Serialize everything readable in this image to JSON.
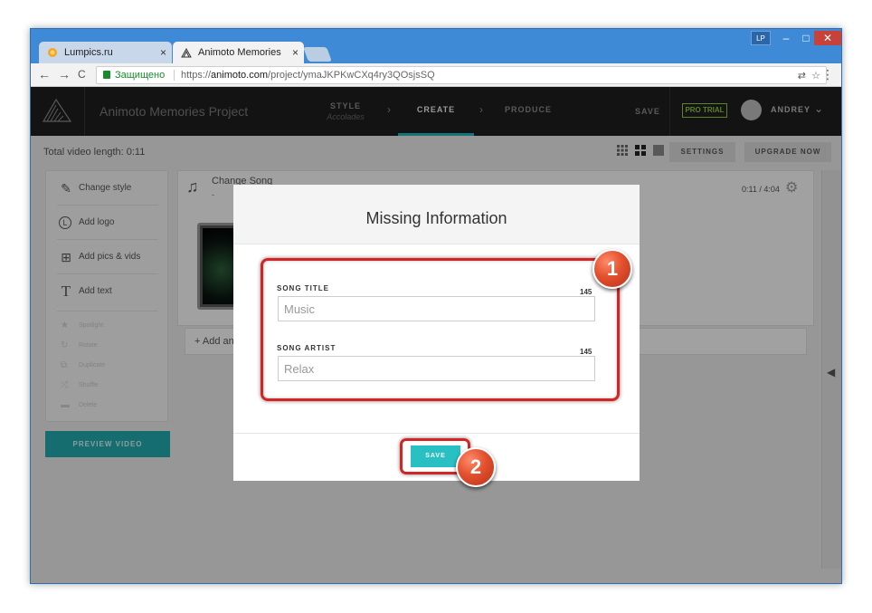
{
  "browser": {
    "tabs": [
      {
        "label": "Lumpics.ru",
        "close": "×"
      },
      {
        "label": "Animoto Memories",
        "close": "×"
      }
    ],
    "window_buttons": {
      "lp": "LP",
      "min": "–",
      "max": "□",
      "close": "✕"
    },
    "nav": {
      "back": "←",
      "forward": "→",
      "reload": "C"
    },
    "secure_label": "Защищено",
    "url_scheme": "https://",
    "url_host": "animoto.com",
    "url_path": "/project/ymaJKPKwCXq4ry3QOsjsSQ",
    "menu": "⋮"
  },
  "app": {
    "project_title": "Animoto Memories Project",
    "steps": {
      "style": "STYLE",
      "style_sub": "Accolades",
      "create": "CREATE",
      "produce": "PRODUCE"
    },
    "save": "SAVE",
    "pro_trial": "PRO TRIAL",
    "user": "ANDREY",
    "video_length": "Total video length: 0:11",
    "settings": "SETTINGS",
    "upgrade": "UPGRADE NOW",
    "sidebar": {
      "items": [
        {
          "label": "Change style",
          "icon": "brush-icon"
        },
        {
          "label": "Add logo",
          "icon": "logo-icon"
        },
        {
          "label": "Add pics & vids",
          "icon": "add-media-icon"
        },
        {
          "label": "Add text",
          "icon": "text-icon"
        }
      ],
      "minor_items": [
        "Spotlight",
        "Rotate",
        "Duplicate",
        "Shuffle",
        "Delete"
      ]
    },
    "preview_button": "PREVIEW VIDEO",
    "song": {
      "label": "Change Song",
      "sub": "-",
      "time": "0:11 / 4:04"
    },
    "add_row": "+ Add an"
  },
  "modal": {
    "title": "Missing Information",
    "fields": [
      {
        "label": "SONG TITLE",
        "count": "145",
        "value": "Music"
      },
      {
        "label": "SONG ARTIST",
        "count": "145",
        "value": "Relax"
      }
    ],
    "save_button": "SAVE"
  },
  "annotations": {
    "badge1": "1",
    "badge2": "2",
    "color": "#d42424"
  }
}
